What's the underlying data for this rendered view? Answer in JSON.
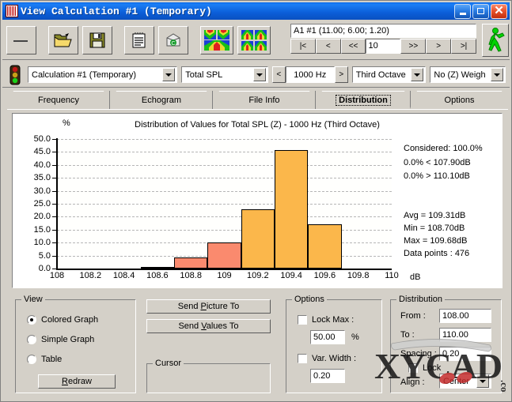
{
  "window": {
    "title": "View Calculation #1 (Temporary)",
    "icon": "app-icon",
    "buttons": {
      "minimize": "minimize",
      "maximize": "maximize",
      "close": "close"
    }
  },
  "toolbar": {
    "items": [
      {
        "name": "new-button",
        "icon": "blank-page-icon"
      },
      {
        "name": "open-button",
        "icon": "open-folder-icon"
      },
      {
        "name": "save-button",
        "icon": "floppy-disk-icon"
      },
      {
        "name": "report-button",
        "icon": "notepad-icon"
      },
      {
        "name": "recalc-button",
        "icon": "recycle-icon"
      },
      {
        "name": "map-button",
        "icon": "color-map-icon"
      },
      {
        "name": "multi-map-button",
        "icon": "multi-map-icon"
      }
    ],
    "runner": {
      "name": "run-button",
      "icon": "walking-man-icon"
    }
  },
  "navigator": {
    "readout": "A1 #1  (11.00; 6.00; 1.20)",
    "first_label": "|<",
    "prev_label": "<",
    "prev_page_label": "<<",
    "step_value": "10",
    "next_page_label": ">>",
    "next_label": ">",
    "last_label": ">|"
  },
  "selectors": {
    "traffic_light": "traffic-light-icon",
    "calculation": "Calculation #1 (Temporary)",
    "quantity": "Total SPL",
    "frequency_prev": "<",
    "frequency": "1000 Hz",
    "frequency_next": ">",
    "band": "Third Octave",
    "weighting": "No (Z) Weigh"
  },
  "tabs": [
    {
      "label": "Frequency",
      "active": false
    },
    {
      "label": "Echogram",
      "active": false
    },
    {
      "label": "File Info",
      "active": false
    },
    {
      "label": "Distribution",
      "active": true
    },
    {
      "label": "Options",
      "active": false
    }
  ],
  "chart_data": {
    "type": "bar",
    "title": "Distribution of Values for Total SPL (Z)  - 1000 Hz (Third Octave)",
    "xlabel": "dB",
    "ylabel": "%",
    "grid": true,
    "xlim": [
      108,
      110
    ],
    "ylim": [
      0,
      50
    ],
    "bin_width": 0.2,
    "x_ticks": [
      "108",
      "108.2",
      "108.4",
      "108.6",
      "108.8",
      "109",
      "109.2",
      "109.4",
      "109.6",
      "109.8",
      "110"
    ],
    "x_tick_values": [
      108,
      108.2,
      108.4,
      108.6,
      108.8,
      109,
      109.2,
      109.4,
      109.6,
      109.8,
      110
    ],
    "y_ticks": [
      "0.0",
      "5.0",
      "10.0",
      "15.0",
      "20.0",
      "25.0",
      "30.0",
      "35.0",
      "40.0",
      "45.0",
      "50.0"
    ],
    "y_tick_values": [
      0,
      5,
      10,
      15,
      20,
      25,
      30,
      35,
      40,
      45,
      50
    ],
    "bins": [
      {
        "start": 108.5,
        "end": 108.7,
        "value": 0.4,
        "color": "#fa8a6e"
      },
      {
        "start": 108.7,
        "end": 108.9,
        "value": 4.2,
        "color": "#fa8a6e"
      },
      {
        "start": 108.9,
        "end": 109.1,
        "value": 10.0,
        "color": "#fa8a6e"
      },
      {
        "start": 109.1,
        "end": 109.3,
        "value": 22.8,
        "color": "#fbb74b"
      },
      {
        "start": 109.3,
        "end": 109.5,
        "value": 45.6,
        "color": "#fbb74b"
      },
      {
        "start": 109.5,
        "end": 109.7,
        "value": 17.0,
        "color": "#fbb74b"
      }
    ],
    "annotations": {
      "considered": "Considered: 100.0%",
      "below": "0.0%  < 107.90dB",
      "above": "0.0%  > 110.10dB",
      "avg": "Avg = 109.31dB",
      "min": "Min = 108.70dB",
      "max": "Max = 109.68dB",
      "points": "Data points : 476"
    }
  },
  "view_group": {
    "title": "View",
    "options": [
      {
        "label": "Colored Graph",
        "selected": true
      },
      {
        "label": "Simple Graph",
        "selected": false
      },
      {
        "label": "Table",
        "selected": false
      }
    ],
    "redraw_button": {
      "prefix": "",
      "accel": "R",
      "rest": "edraw"
    }
  },
  "send_buttons": {
    "picture": {
      "pre": "Send ",
      "accel": "P",
      "post": "icture To"
    },
    "values": {
      "pre": "Send ",
      "accel": "V",
      "post": "alues To"
    }
  },
  "cursor_group": {
    "title": "Cursor"
  },
  "options_group": {
    "title": "Options",
    "lock_max": {
      "label": "Lock Max :",
      "checked": false,
      "value": "50.00",
      "unit": "%"
    },
    "var_width": {
      "label": "Var. Width :",
      "checked": false,
      "value": "0.20"
    }
  },
  "distribution_group": {
    "title": "Distribution",
    "from": {
      "label": "From :",
      "value": "108.00"
    },
    "to": {
      "label": "To :",
      "value": "110.00"
    },
    "spacing": {
      "label": "Spacing :",
      "value": "0.20"
    },
    "lock": {
      "label": "Lock",
      "checked": false
    },
    "align": {
      "label": "Align :",
      "value": "Center"
    }
  },
  "watermark": {
    "text": "XYCAD",
    "suffix": ".com"
  },
  "colors": {
    "titlebar": "#0b5ed8",
    "face": "#d4d0c8",
    "bar_warm": "#fa8a6e",
    "bar_orange": "#fbb74b",
    "grid": "#b6b6b6"
  }
}
